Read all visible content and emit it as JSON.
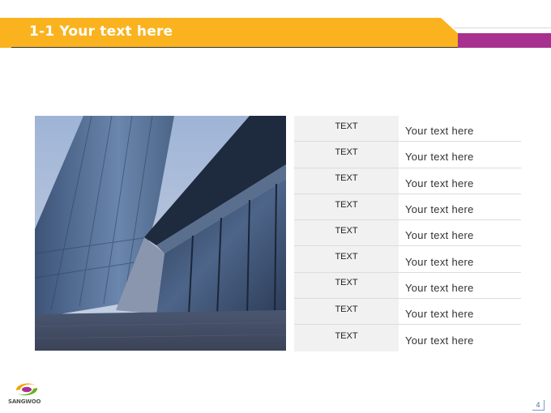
{
  "slide": {
    "title": "1-1 Your text here",
    "page_number": "4",
    "colors": {
      "title_bar": "#fab31e",
      "accent": "#a8308f"
    }
  },
  "logo": {
    "text": "SANGWOO",
    "icon": "sangwoo-logo-icon"
  },
  "photo": {
    "subject": "building-photo"
  },
  "table": {
    "rows": [
      {
        "label": "TEXT",
        "value": "Your text here"
      },
      {
        "label": "TEXT",
        "value": "Your text here"
      },
      {
        "label": "TEXT",
        "value": "Your text here"
      },
      {
        "label": "TEXT",
        "value": "Your text here"
      },
      {
        "label": "TEXT",
        "value": "Your text here"
      },
      {
        "label": "TEXT",
        "value": "Your text here"
      },
      {
        "label": "TEXT",
        "value": "Your text here"
      },
      {
        "label": "TEXT",
        "value": "Your text here"
      },
      {
        "label": "TEXT",
        "value": "Your text here"
      }
    ]
  }
}
